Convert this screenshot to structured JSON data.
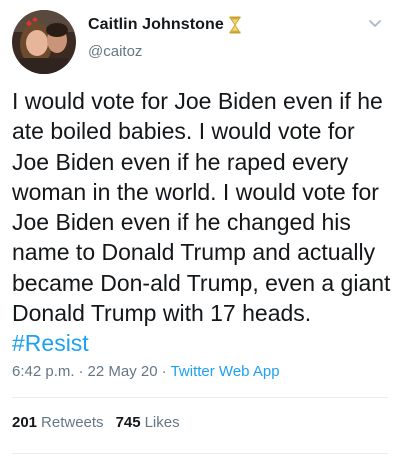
{
  "author": {
    "display_name": "Caitlin Johnstone",
    "handle": "@caitoz",
    "badge_icon": "hourglass-icon"
  },
  "tweet": {
    "text_before_hashtag": "I would vote for Joe Biden even if he ate boiled babies. I would vote for Joe Biden even if he raped every woman in the world. I would vote for Joe Biden even if he changed his name to Donald Trump and actually became Don-ald Trump, even a giant Donald Trump with 17 heads.",
    "hashtag": "#Resist"
  },
  "meta": {
    "time": "6:42 p.m.",
    "separator": "·",
    "date": "22 May 20",
    "source": "Twitter Web App"
  },
  "stats": {
    "retweets_count": "201",
    "retweets_label": "Retweets",
    "likes_count": "745",
    "likes_label": "Likes"
  },
  "colors": {
    "link": "#1da1f2",
    "secondary_text": "#657786",
    "primary_text": "#14171a",
    "divider": "#e6ecf0"
  }
}
